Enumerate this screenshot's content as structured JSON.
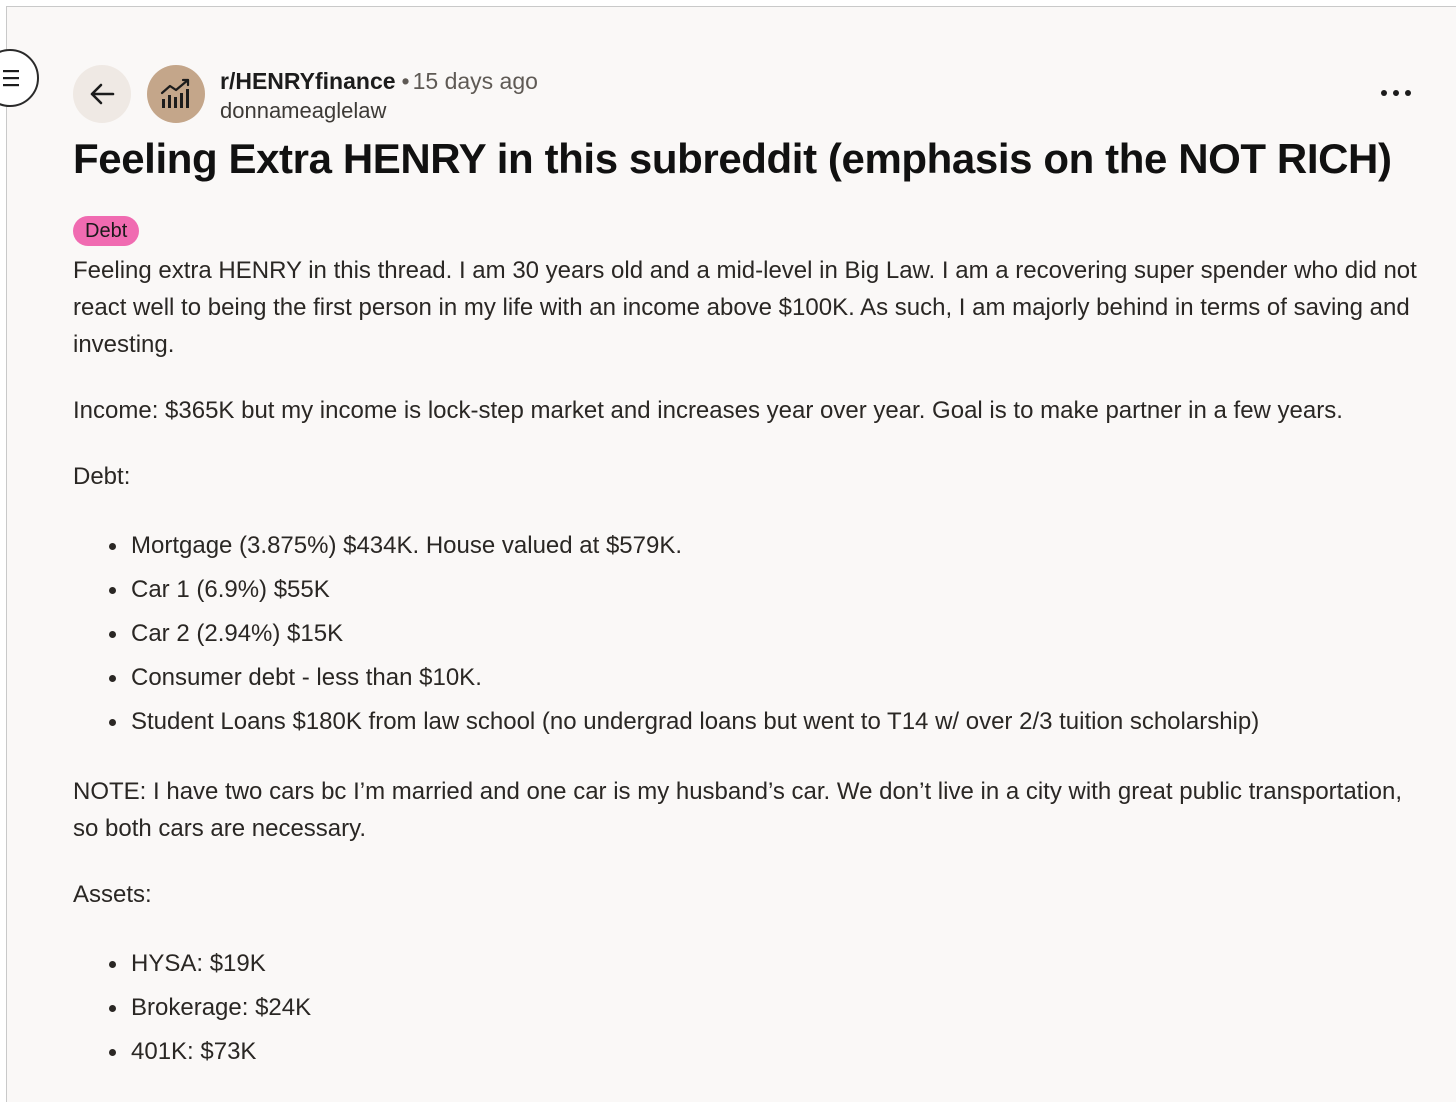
{
  "post": {
    "subreddit": "r/HENRYfinance",
    "separator": "•",
    "time_ago": "15 days ago",
    "author": "donnameaglelaw",
    "title": "Feeling Extra HENRY in this subreddit (emphasis on the NOT RICH)",
    "flair": "Debt",
    "flair_color": "#f06bb1",
    "icons": {
      "back": "arrow-left-icon",
      "avatar": "bar-chart-icon",
      "more": "more-horizontal-icon",
      "menu": "hamburger-menu-icon"
    },
    "body": {
      "intro": "Feeling extra HENRY in this thread. I am 30 years old and a mid-level in Big Law. I am a recovering super spender who did not react well to being the first person in my life with an income above $100K. As such, I am majorly behind in terms of saving and investing.",
      "income": "Income: $365K but my income is lock-step market and increases year over year. Goal is to make partner in a few years.",
      "debt_heading": "Debt:",
      "debt_items": [
        "Mortgage (3.875%) $434K. House valued at $579K.",
        "Car 1 (6.9%) $55K",
        "Car 2 (2.94%) $15K",
        "Consumer debt - less than $10K.",
        "Student Loans $180K from law school (no undergrad loans but went to T14 w/ over 2/3 tuition scholarship)"
      ],
      "note": "NOTE: I have two cars bc I’m married and one car is my husband’s car. We don’t live in a city with great public transportation, so both cars are necessary.",
      "assets_heading": "Assets:",
      "asset_items": [
        "HYSA: $19K",
        "Brokerage: $24K",
        "401K: $73K"
      ]
    }
  }
}
